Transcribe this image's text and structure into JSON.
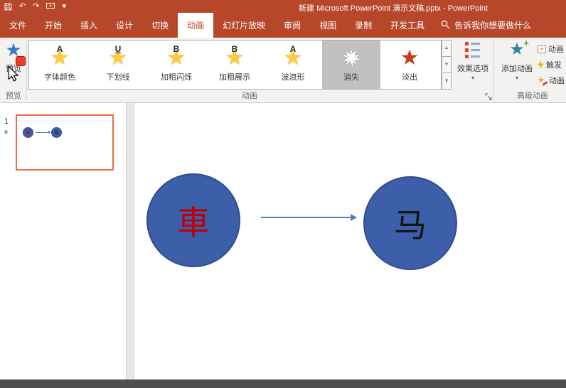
{
  "titlebar": {
    "title": "新建 Microsoft PowerPoint 演示文稿.pptx - PowerPoint"
  },
  "ribbon_tabs": [
    {
      "label": "文件"
    },
    {
      "label": "开始"
    },
    {
      "label": "插入"
    },
    {
      "label": "设计"
    },
    {
      "label": "切换"
    },
    {
      "label": "动画",
      "active": true
    },
    {
      "label": "幻灯片放映"
    },
    {
      "label": "审阅"
    },
    {
      "label": "视图"
    },
    {
      "label": "录制"
    },
    {
      "label": "开发工具"
    }
  ],
  "search": {
    "label": "告诉我你想要做什么"
  },
  "preview_group": {
    "button_label": "预览",
    "group_label": "预览"
  },
  "animation_group": {
    "group_label": "动画",
    "gallery": [
      {
        "label": "字体颜色",
        "letter": "A"
      },
      {
        "label": "下划线",
        "letter": "U"
      },
      {
        "label": "加粗闪烁",
        "letter": "B"
      },
      {
        "label": "加粗展示",
        "letter": "B"
      },
      {
        "label": "波浪形",
        "letter": "A"
      },
      {
        "label": "消失",
        "selected": true
      },
      {
        "label": "淡出"
      }
    ],
    "effect_options_label": "效果选项"
  },
  "advanced_group": {
    "group_label": "高级动画",
    "add_animation_label": "添加动画",
    "buttons": [
      {
        "label": "动画"
      },
      {
        "label": "触发"
      },
      {
        "label": "动画"
      }
    ]
  },
  "thumbnail_panel": {
    "slide_number": "1"
  },
  "slide": {
    "left_shape_text": "車",
    "right_shape_text": "马"
  },
  "icons": {
    "star": "★",
    "caret": "▾",
    "up_arrow": "▲",
    "down_arrow": "▼",
    "undo": "↶",
    "redo": "↷",
    "plus": "+"
  },
  "colors": {
    "brand_red": "#B7472A",
    "shape_blue": "#3D5EA9",
    "selected_gray": "#C3C1BF",
    "selection_border": "#ED6C47",
    "left_text_red": "#C00000"
  }
}
